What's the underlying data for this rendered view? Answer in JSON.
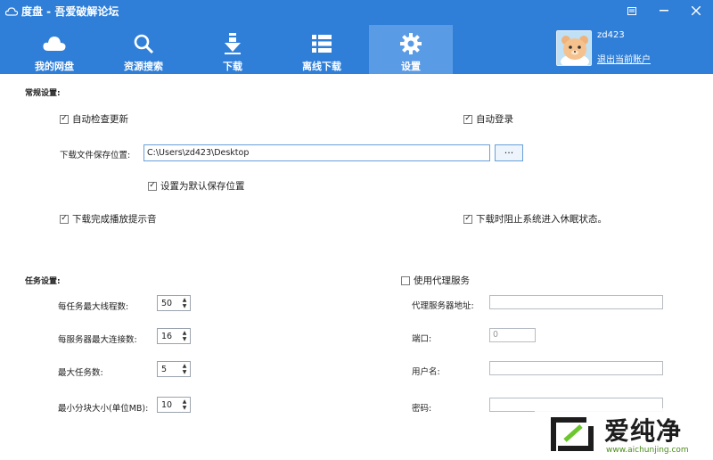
{
  "window": {
    "title": "度盘 - 吾爱破解论坛",
    "controls": [
      "settings-icon",
      "minimize-icon",
      "close-icon"
    ]
  },
  "nav": {
    "items": [
      {
        "label": "我的网盘",
        "icon": "cloud-icon"
      },
      {
        "label": "资源搜索",
        "icon": "search-icon"
      },
      {
        "label": "下载",
        "icon": "download-icon"
      },
      {
        "label": "离线下载",
        "icon": "list-icon"
      },
      {
        "label": "设置",
        "icon": "gear-icon",
        "active": true
      }
    ]
  },
  "user": {
    "name": "zd423",
    "logout_label": "退出当前账户"
  },
  "general": {
    "title": "常规设置:",
    "auto_update": {
      "label": "自动检查更新",
      "checked": true
    },
    "auto_login": {
      "label": "自动登录",
      "checked": true
    },
    "save_path_label": "下载文件保存位置:",
    "save_path_value": "C:\\Users\\zd423\\Desktop",
    "browse_label": "···",
    "set_default": {
      "label": "设置为默认保存位置",
      "checked": true
    },
    "play_sound": {
      "label": "下载完成播放提示音",
      "checked": true
    },
    "prevent_sleep": {
      "label": "下载时阻止系统进入休眠状态。",
      "checked": true
    }
  },
  "task": {
    "title": "任务设置:",
    "max_threads": {
      "label": "每任务最大线程数:",
      "value": "50"
    },
    "max_conn": {
      "label": "每服务器最大连接数:",
      "value": "16"
    },
    "max_tasks": {
      "label": "最大任务数:",
      "value": "5"
    },
    "min_chunk": {
      "label": "最小分块大小(单位MB):",
      "value": "10"
    }
  },
  "proxy": {
    "use_proxy": {
      "label": "使用代理服务",
      "checked": false
    },
    "server_label": "代理服务器地址:",
    "port_label": "端口:",
    "port_placeholder": "0",
    "user_label": "用户名:",
    "pass_label": "密码:"
  },
  "watermark": {
    "name": "爱纯净",
    "url": "www.aichunjing.com"
  },
  "colors": {
    "header_bg": "#2f7fd9",
    "active_tab": "#5a9be6"
  }
}
